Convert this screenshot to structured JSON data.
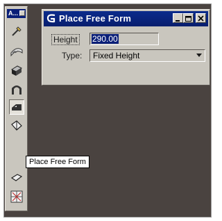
{
  "palette": {
    "title": "A...",
    "tools": [
      {
        "name": "place-slab-icon"
      },
      {
        "name": "place-cylinder-icon"
      },
      {
        "name": "place-box-icon"
      },
      {
        "name": "place-cone-icon"
      },
      {
        "name": "place-torus-icon"
      },
      {
        "name": "place-free-form-icon"
      },
      {
        "name": "place-wedge-icon"
      },
      {
        "name": "place-sphere-icon"
      },
      {
        "name": "place-grid-icon"
      }
    ]
  },
  "dialog": {
    "title": "Place Free Form",
    "height_label": "Height",
    "height_value": "290.00",
    "type_label": "Type:",
    "type_value": "Fixed Height"
  },
  "tooltip": {
    "text": "Place Free Form"
  },
  "colors": {
    "background": "#4a4340",
    "titlebar": "#0b2b8c",
    "panel": "#c9c6be"
  }
}
